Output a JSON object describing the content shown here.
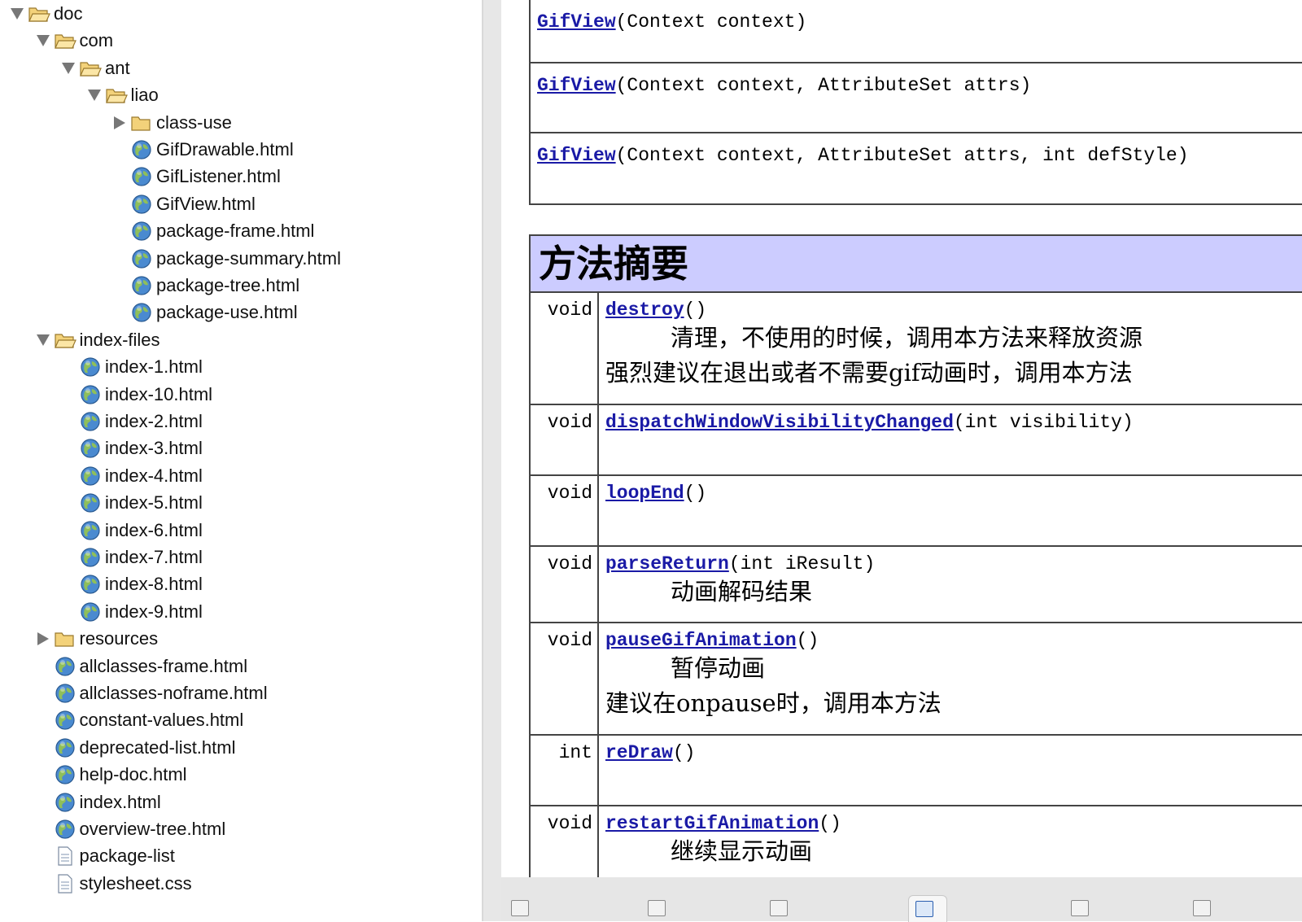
{
  "tree": {
    "items": [
      {
        "label": "doc",
        "level": 0,
        "kind": "folder",
        "expanded": true
      },
      {
        "label": "com",
        "level": 1,
        "kind": "folder",
        "expanded": true
      },
      {
        "label": "ant",
        "level": 2,
        "kind": "folder",
        "expanded": true
      },
      {
        "label": "liao",
        "level": 3,
        "kind": "folder",
        "expanded": true
      },
      {
        "label": "class-use",
        "level": 4,
        "kind": "folder",
        "expanded": false
      },
      {
        "label": "GifDrawable.html",
        "level": 4,
        "kind": "html"
      },
      {
        "label": "GifListener.html",
        "level": 4,
        "kind": "html"
      },
      {
        "label": "GifView.html",
        "level": 4,
        "kind": "html"
      },
      {
        "label": "package-frame.html",
        "level": 4,
        "kind": "html"
      },
      {
        "label": "package-summary.html",
        "level": 4,
        "kind": "html"
      },
      {
        "label": "package-tree.html",
        "level": 4,
        "kind": "html"
      },
      {
        "label": "package-use.html",
        "level": 4,
        "kind": "html"
      },
      {
        "label": "index-files",
        "level": 1,
        "kind": "folder",
        "expanded": true
      },
      {
        "label": "index-1.html",
        "level": 2,
        "kind": "html"
      },
      {
        "label": "index-10.html",
        "level": 2,
        "kind": "html"
      },
      {
        "label": "index-2.html",
        "level": 2,
        "kind": "html"
      },
      {
        "label": "index-3.html",
        "level": 2,
        "kind": "html"
      },
      {
        "label": "index-4.html",
        "level": 2,
        "kind": "html"
      },
      {
        "label": "index-5.html",
        "level": 2,
        "kind": "html"
      },
      {
        "label": "index-6.html",
        "level": 2,
        "kind": "html"
      },
      {
        "label": "index-7.html",
        "level": 2,
        "kind": "html"
      },
      {
        "label": "index-8.html",
        "level": 2,
        "kind": "html"
      },
      {
        "label": "index-9.html",
        "level": 2,
        "kind": "html"
      },
      {
        "label": "resources",
        "level": 1,
        "kind": "folder",
        "expanded": false
      },
      {
        "label": "allclasses-frame.html",
        "level": 1,
        "kind": "html"
      },
      {
        "label": "allclasses-noframe.html",
        "level": 1,
        "kind": "html"
      },
      {
        "label": "constant-values.html",
        "level": 1,
        "kind": "html"
      },
      {
        "label": "deprecated-list.html",
        "level": 1,
        "kind": "html"
      },
      {
        "label": "help-doc.html",
        "level": 1,
        "kind": "html"
      },
      {
        "label": "index.html",
        "level": 1,
        "kind": "html"
      },
      {
        "label": "overview-tree.html",
        "level": 1,
        "kind": "html"
      },
      {
        "label": "package-list",
        "level": 1,
        "kind": "file"
      },
      {
        "label": "stylesheet.css",
        "level": 1,
        "kind": "file"
      }
    ]
  },
  "constructors": [
    {
      "name": "GifView",
      "params": "(Context context)"
    },
    {
      "name": "GifView",
      "params": "(Context context, AttributeSet attrs)"
    },
    {
      "name": "GifView",
      "params": "(Context context, AttributeSet attrs, int defStyle)"
    }
  ],
  "method_summary": {
    "title": "方法摘要",
    "methods": [
      {
        "ret": "void",
        "name": "destroy",
        "params": "()",
        "desc": [
          "清理，不使用的时候，调用本方法来释放资源",
          "强烈建议在退出或者不需要gif动画时，调用本方法"
        ]
      },
      {
        "ret": "void",
        "name": "dispatchWindowVisibilityChanged",
        "params": "(int visibility)",
        "desc": []
      },
      {
        "ret": "void",
        "name": "loopEnd",
        "params": "()",
        "desc": []
      },
      {
        "ret": "void",
        "name": "parseReturn",
        "params": "(int iResult)",
        "desc": [
          "动画解码结果"
        ]
      },
      {
        "ret": "void",
        "name": "pauseGifAnimation",
        "params": "()",
        "desc": [
          "暂停动画",
          "建议在onpause时，调用本方法"
        ]
      },
      {
        "ret": "int",
        "name": "reDraw",
        "params": "()",
        "desc": []
      },
      {
        "ret": "void",
        "name": "restartGifAnimation",
        "params": "()",
        "desc": [
          "继续显示动画"
        ]
      }
    ]
  },
  "colors": {
    "link": "#1a1aa6",
    "table_header_bg": "#ccccff",
    "table_border": "#444444",
    "folder": "#e2b45a",
    "globe": "#3a7fc4"
  },
  "icons": {
    "folder": "folder-icon",
    "html": "globe-icon",
    "file": "file-icon",
    "expanded": "chevron-down-icon",
    "collapsed": "chevron-right-icon"
  }
}
